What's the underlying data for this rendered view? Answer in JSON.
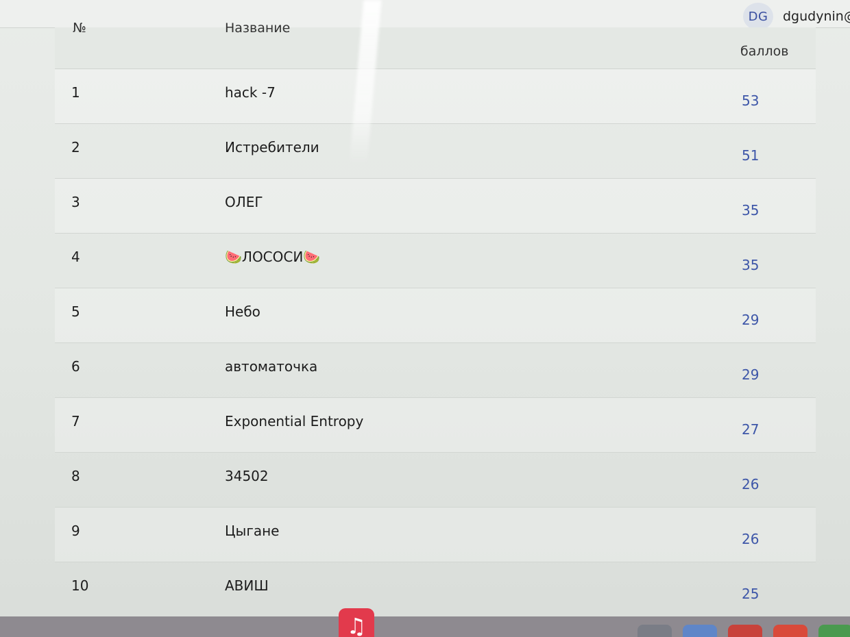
{
  "header": {
    "avatar_initials": "DG",
    "username": "dgudynin@"
  },
  "table": {
    "columns": {
      "num": "№",
      "name": "Название",
      "score": "баллов"
    },
    "rows": [
      {
        "num": "1",
        "name": "hack -7",
        "score": "53"
      },
      {
        "num": "2",
        "name": "Истребители",
        "score": "51"
      },
      {
        "num": "3",
        "name": "ОЛЕГ",
        "score": "35"
      },
      {
        "num": "4",
        "name": "🍉ЛОСОСИ🍉",
        "score": "35"
      },
      {
        "num": "5",
        "name": "Небо",
        "score": "29"
      },
      {
        "num": "6",
        "name": "автоматочка",
        "score": "29"
      },
      {
        "num": "7",
        "name": "Exponential Entropy",
        "score": "27"
      },
      {
        "num": "8",
        "name": "34502",
        "score": "26"
      },
      {
        "num": "9",
        "name": "Цыгане",
        "score": "26"
      },
      {
        "num": "10",
        "name": "АВИШ",
        "score": "25"
      }
    ]
  },
  "dock": {
    "music_icon": "music-note-icon",
    "music_glyph": "♫"
  },
  "colors": {
    "score_text": "#3d56a8",
    "music_app": "#e23a4c"
  }
}
